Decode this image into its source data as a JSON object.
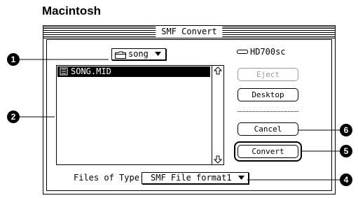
{
  "heading": "Macintosh",
  "dialog": {
    "title": "SMF Convert",
    "folder_popup": "song",
    "drive_label": "HD700sc",
    "file_list": [
      "SONG.MID"
    ],
    "buttons": {
      "eject": "Eject",
      "desktop": "Desktop",
      "cancel": "Cancel",
      "convert": "Convert"
    },
    "files_of_type_label": "Files of Type:",
    "files_of_type_value": "SMF File format1"
  },
  "callouts": {
    "folder_popup": "1",
    "file_list": "2",
    "files_of_type": "4",
    "convert": "5",
    "cancel": "6"
  },
  "colors": {
    "foreground": "#000000",
    "background": "#ffffff",
    "disabled": "#9a9a9a"
  },
  "icons": {
    "folder": "folder-icon",
    "dropdown": "triangle-down-icon",
    "drive": "hard-drive-icon",
    "midi_file": "midi-file-icon",
    "scroll_up": "arrow-up-icon",
    "scroll_down": "arrow-down-icon"
  }
}
